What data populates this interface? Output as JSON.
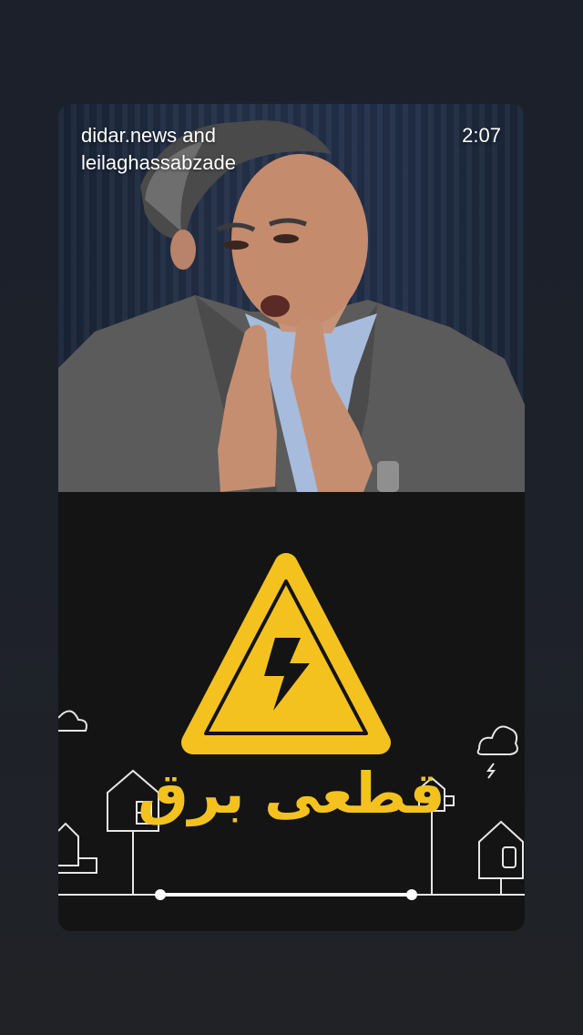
{
  "story": {
    "author_line1": "didar.news and",
    "author_line2": "leilaghassabzade",
    "timestamp": "2:07"
  },
  "poster": {
    "title": "قطعی برق",
    "accent_color": "#f4c21f",
    "icon": "lightning-warning-icon"
  },
  "colors": {
    "background": "#1d212a",
    "card_background": "#141414",
    "suit": "#5a5a5a",
    "shirt": "#9db3d6"
  }
}
